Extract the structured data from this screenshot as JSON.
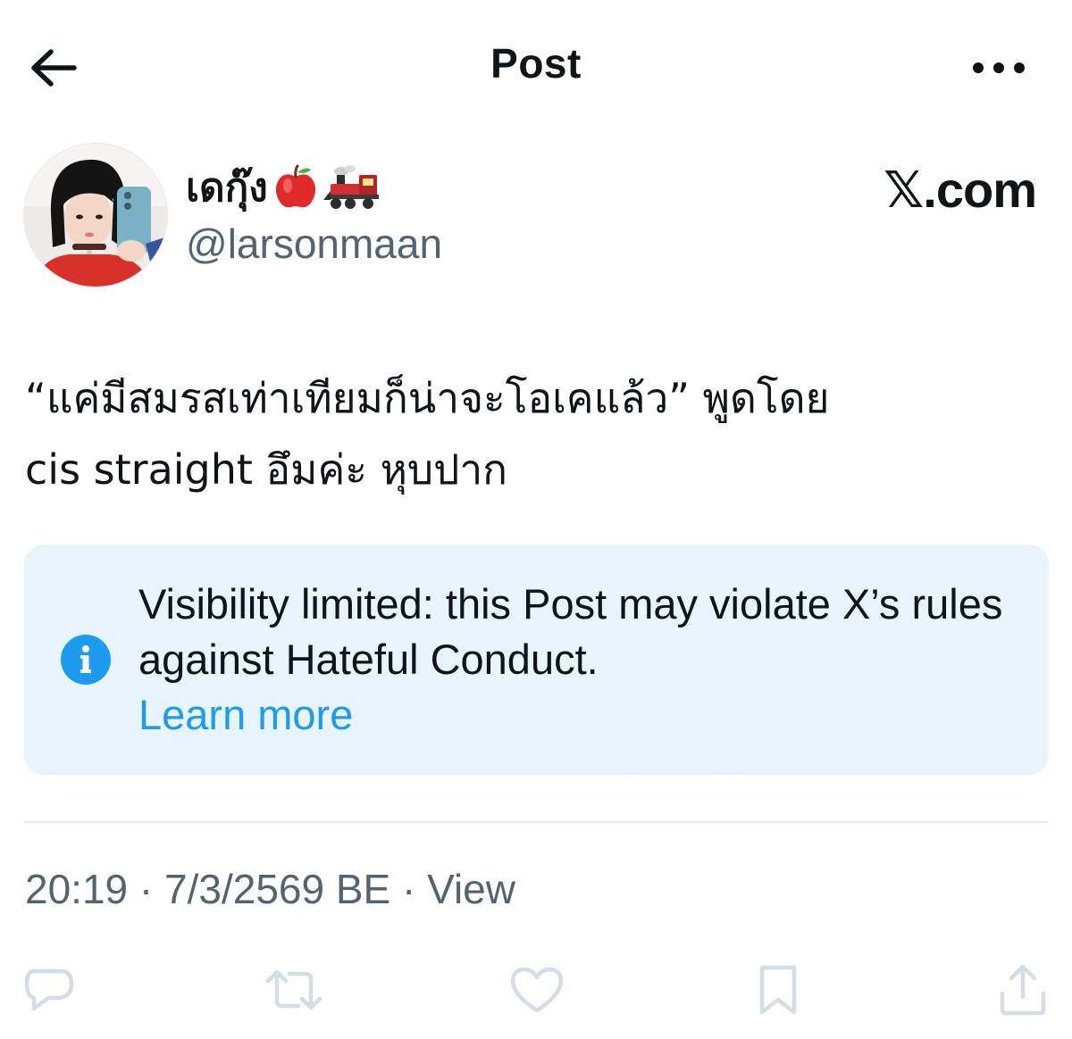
{
  "header": {
    "title": "Post",
    "back_icon": "arrow-left-icon",
    "more_icon": "more-horizontal-icon"
  },
  "author": {
    "display_name": "เดกุ๊ง",
    "name_emojis": [
      "red-apple-emoji",
      "steam-locomotive-emoji"
    ],
    "username": "@larsonmaan"
  },
  "source_label": "𝕏.com",
  "post": {
    "text": "“แค่มีสมรสเท่าเทียมก็น่าจะโอเคแล้ว” พูดโดย\ncis straight  อึมค่ะ หุบปาก"
  },
  "notice": {
    "text": "Visibility limited: this Post may violate X’s rules against Hateful Conduct.",
    "link_label": "Learn more",
    "icon": "info-icon"
  },
  "meta": {
    "time": "20:19",
    "date": "7/3/2569 BE",
    "separator": " · ",
    "views_label": "View"
  },
  "actions": [
    "reply-icon",
    "repost-icon",
    "like-icon",
    "bookmark-icon",
    "share-icon"
  ],
  "colors": {
    "text": "#0f1419",
    "secondary": "#536471",
    "accent": "#1d9bf0",
    "notice_bg": "#e8f4fc",
    "action_icon": "#d3dde6"
  }
}
